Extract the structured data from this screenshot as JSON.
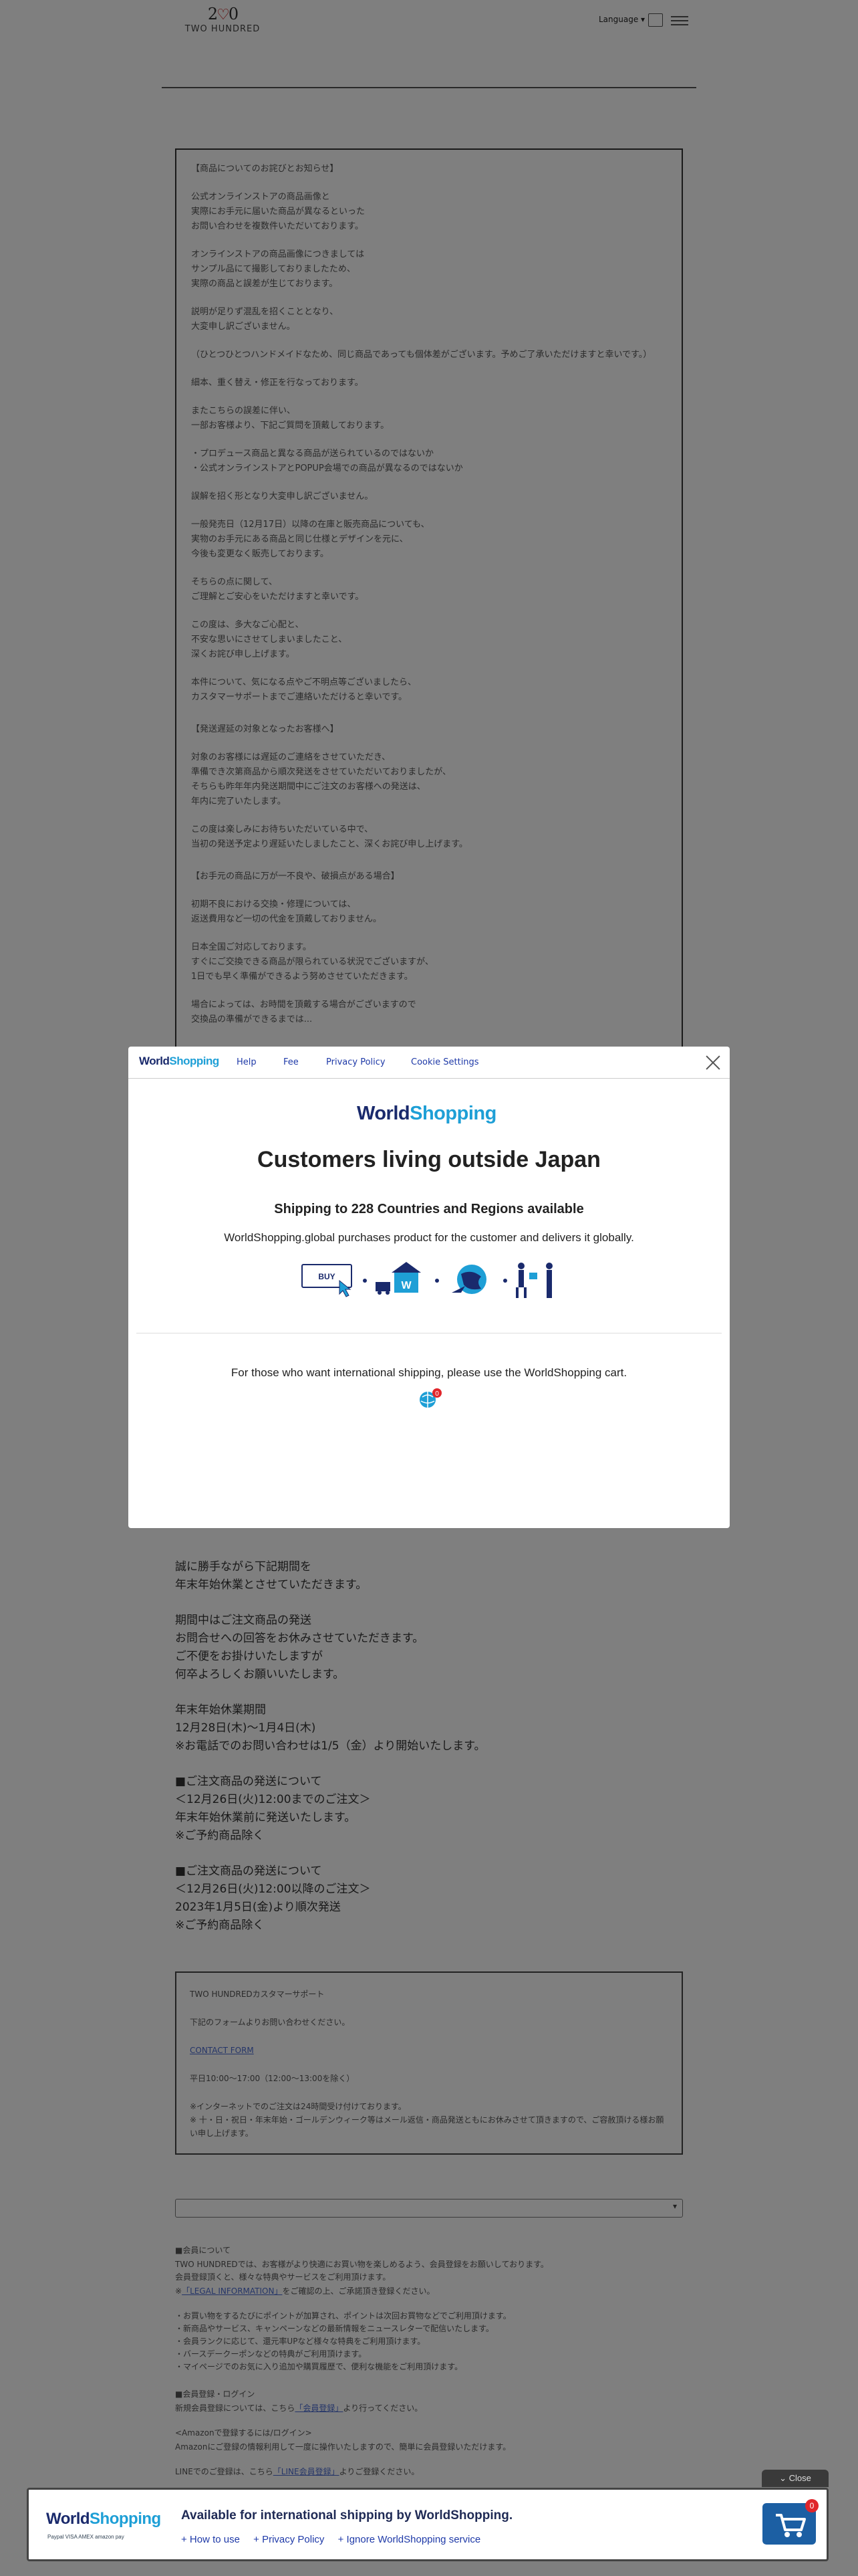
{
  "header": {
    "logo_text": "TWO HUNDRED",
    "language_label": "Language ▾"
  },
  "notice": {
    "paragraphs": [
      "【商品についてのお詫びとお知らせ】",
      "公式オンラインストアの商品画像と\n実際にお手元に届いた商品が異なるといった\nお問い合わせを複数件いただいております。",
      "オンラインストアの商品画像につきましては\nサンプル品にて撮影しておりましたため、\n実際の商品と誤差が生じております。",
      "説明が足りず混乱を招くこととなり、\n大変申し訳ございません。",
      "（ひとつひとつハンドメイドなため、同じ商品であっても個体差がございます。予めご了承いただけますと幸いです。）",
      "細本、重く替え・修正を行なっております。",
      "またこちらの誤差に伴い、\n一部お客様より、下記ご質問を頂戴しております。",
      "・プロデュース商品と異なる商品が送られているのではないか\n・公式オンラインストアとPOPUP会場での商品が異なるのではないか",
      "誤解を招く形となり大変申し訳ございません。",
      "一般発売日（12月17日）以降の在庫と販売商品についても、\n実物のお手元にある商品と同じ仕様とデザインを元に、\n今後も変更なく販売しております。",
      "そちらの点に関して、\nご理解とご安心をいただけますと幸いです。",
      "この度は、多大なご心配と、\n不安な思いにさせてしまいましたこと、\n深くお詫び申し上げます。",
      "本件について、気になる点やご不明点等ございましたら、\nカスタマーサポートまでご連絡いただけると幸いです。",
      "【発送遅延の対象となったお客様へ】",
      "対象のお客様には遅延のご連絡をさせていただき、\n準備でき次第商品から順次発送をさせていただいておりましたが、\nそちらも昨年年内発送期間中にご注文のお客様への発送は、\n年内に完了いたします。",
      "この度は楽しみにお待ちいただいている中で、\n当初の発送予定より遅延いたしましたこと、深くお詫び申し上げます。",
      "【お手元の商品に万が一不良や、破損点がある場合】",
      "初期不良における交換・修理については、\n返送費用など一切の代金を頂戴しておりません。",
      "日本全国ご対応しております。\nすぐにご交換できる商品が限られている状況でございますが、\n1日でも早く準備ができるよう努めさせていただきます。",
      "場合によっては、お時間を頂戴する場合がございますので\n交換品の準備ができるまでは..."
    ]
  },
  "modal": {
    "nav": {
      "logo": {
        "w": "World",
        "s": "Shopping"
      },
      "help": "Help",
      "fee": "Fee",
      "privacy": "Privacy Policy",
      "cookie": "Cookie Settings"
    },
    "big_logo": {
      "w": "World",
      "s": "Shopping"
    },
    "title": "Customers living outside Japan",
    "shipping": "Shipping to 228 Countries and Regions available",
    "description": "WorldShopping.global purchases product for the customer and delivers it globally.",
    "flow": {
      "buy_label": "BUY"
    },
    "footer": "For those who want international shipping, please use the WorldShopping cart.",
    "cart_badge": "0"
  },
  "body_text": {
    "paragraphs": [
      "誠に勝手ながら下記期間を\n年末年始休業とさせていただきます。",
      "期間中はご注文商品の発送\nお問合せへの回答をお休みさせていただきます。\nご不便をお掛けいたしますが\n何卒よろしくお願いいたします。",
      "年末年始休業期間\n12月28日(木)〜1月4日(木)\n※お電話でのお問い合わせは1/5（金）より開始いたします。",
      "■ご注文商品の発送について\n＜12月26日(火)12:00までのご注文＞\n年末年始休業前に発送いたします。\n※ご予約商品除く",
      "■ご注文商品の発送について\n＜12月26日(火)12:00以降のご注文＞\n2023年1月5日(金)より順次発送\n※ご予約商品除く"
    ]
  },
  "support": {
    "title": "TWO HUNDREDカスタマーサポート",
    "intro": "下記のフォームよりお問い合わせください。",
    "contact_link": "CONTACT FORM",
    "hours": "平日10:00～17:00（12:00～13:00を除く）",
    "note": "※インターネットでのご注文は24時間受け付けております。\n※ 十・日・祝日・年末年始・ゴールデンウィーク等はメール返信・商品発送ともにお休みさせて頂きますので、ご容赦頂ける様お願い申し上げます。"
  },
  "select": {
    "value": ""
  },
  "members": {
    "heading": "■会員について",
    "intro": "TWO HUNDREDでは、お客様がより快適にお買い物を楽しめるよう、会員登録をお願いしております。\n会員登録頂くと、様々な特典やサービスをご利用頂けます。",
    "legal_prefix": "※",
    "legal_link": "「LEGAL INFORMATION」",
    "legal_suffix": "をご確認の上、ご承諾頂き登録ください。",
    "benefits": [
      "お買い物をするたびにポイントが加算され、ポイントは次回お買物などでご利用頂けます。",
      "新商品やサービス、キャンペーンなどの最新情報をニュースレターで配信いたします。",
      "会員ランクに応じて、還元率UPなど様々な特典をご利用頂けます。",
      "バースデークーポンなどの特典がご利用頂けます。",
      "マイページでのお気に入り追加や購買履歴で、便利な機能をご利用頂けます。"
    ],
    "login_heading": "■会員登録・ログイン",
    "login_text_prefix": "新規会員登録については、こちら",
    "login_link": "「会員登録」",
    "login_text_suffix": "より行ってください。",
    "amazon_heading": "<Amazonで登録するには/ログイン>",
    "amazon_text": "Amazonにご登録の情報利用して一度に操作いたしますので、簡単に会員登録いただけます。",
    "extra_line_prefix": "LINEでのご登録は、こちら",
    "extra_link": "「LINE会員登録」",
    "extra_line_suffix": "よりご登録ください。"
  },
  "banner": {
    "close_label": "⌄ Close",
    "logo": {
      "w": "World",
      "s": "Shopping"
    },
    "payment_text": "Paypal  VISA  AMEX  amazon pay",
    "title": "Available for international shipping by WorldShopping.",
    "links": [
      "+ How to use",
      "+ Privacy Policy",
      "+ Ignore WorldShopping service"
    ],
    "cart_count": "0"
  }
}
